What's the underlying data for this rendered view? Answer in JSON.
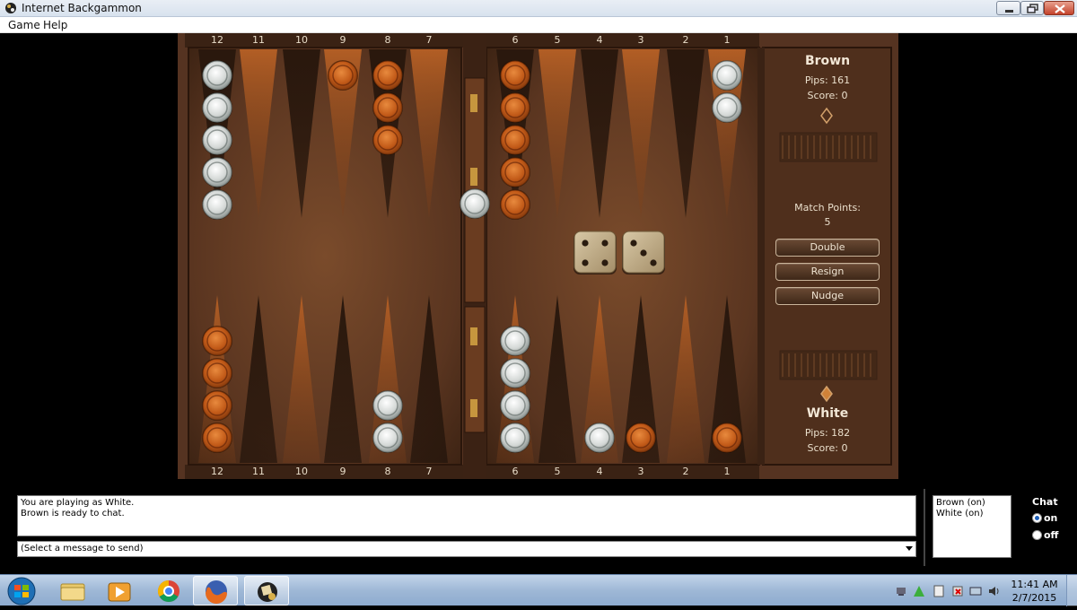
{
  "window": {
    "title": "Internet Backgammon"
  },
  "menu": {
    "game": "Game",
    "help": "Help"
  },
  "board": {
    "top_points": [
      "12",
      "11",
      "10",
      "9",
      "8",
      "7",
      "6",
      "5",
      "4",
      "3",
      "2",
      "1"
    ],
    "bottom_points": [
      "12",
      "11",
      "10",
      "9",
      "8",
      "7",
      "6",
      "5",
      "4",
      "3",
      "2",
      "1"
    ],
    "checkers": {
      "top": [
        {
          "label": "12",
          "color": "white",
          "count": 5
        },
        {
          "label": "9",
          "color": "brown",
          "count": 1
        },
        {
          "label": "8",
          "color": "brown",
          "count": 3
        },
        {
          "label": "6",
          "color": "brown",
          "count": 5
        },
        {
          "label": "1",
          "color": "white",
          "count": 2
        }
      ],
      "bottom": [
        {
          "label": "12",
          "color": "brown",
          "count": 4
        },
        {
          "label": "8",
          "color": "white",
          "count": 2
        },
        {
          "label": "6",
          "color": "white",
          "count": 4
        },
        {
          "label": "4",
          "color": "white",
          "count": 1
        },
        {
          "label": "3",
          "color": "brown",
          "count": 1
        },
        {
          "label": "1",
          "color": "brown",
          "count": 1
        }
      ],
      "bar": [
        {
          "color": "white",
          "count": 1
        }
      ]
    },
    "dice": [
      4,
      3
    ]
  },
  "panel": {
    "brown": {
      "name": "Brown",
      "pips": "Pips: 161",
      "score": "Score: 0"
    },
    "white": {
      "name": "White",
      "pips": "Pips: 182",
      "score": "Score: 0"
    },
    "match_label": "Match Points:",
    "match_value": "5",
    "buttons": {
      "double": "Double",
      "resign": "Resign",
      "nudge": "Nudge"
    }
  },
  "chat": {
    "log": [
      "You are playing as White.",
      "Brown is ready to chat."
    ],
    "select_placeholder": "(Select a message to send)",
    "players": [
      "Brown (on)",
      "White (on)"
    ],
    "label": "Chat",
    "on": "on",
    "off": "off",
    "selected": "on"
  },
  "taskbar": {
    "apps": [
      "start-orb",
      "windows-explorer",
      "media-player",
      "chrome",
      "firefox",
      "internet-backgammon"
    ],
    "clock_time": "11:41 AM",
    "clock_date": "2/7/2015"
  },
  "colors": {
    "brown_checker": "#c85a12",
    "white_checker": "#d8dcda",
    "wood": "#5a3722",
    "point_light": "#b8652a",
    "point_dark": "#2a1a10"
  }
}
